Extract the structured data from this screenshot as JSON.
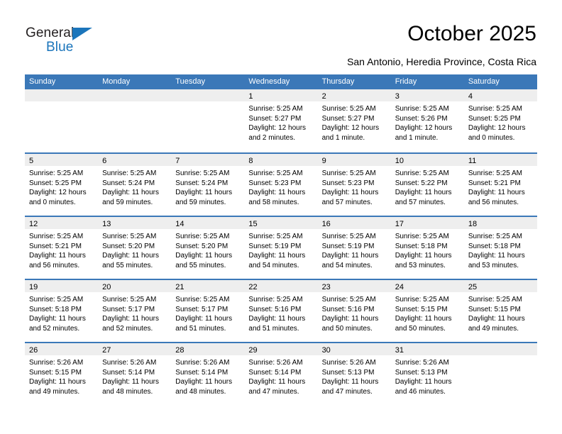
{
  "brand": {
    "name_top": "General",
    "name_bottom": "Blue",
    "accent_color": "#1b75bb"
  },
  "header": {
    "title": "October 2025",
    "subtitle": "San Antonio, Heredia Province, Costa Rica"
  },
  "calendar": {
    "header_color": "#3b78b8",
    "weekdays": [
      "Sunday",
      "Monday",
      "Tuesday",
      "Wednesday",
      "Thursday",
      "Friday",
      "Saturday"
    ],
    "weeks": [
      [
        {
          "day": "",
          "sunrise": "",
          "sunset": "",
          "daylight": "",
          "daylight2": ""
        },
        {
          "day": "",
          "sunrise": "",
          "sunset": "",
          "daylight": "",
          "daylight2": ""
        },
        {
          "day": "",
          "sunrise": "",
          "sunset": "",
          "daylight": "",
          "daylight2": ""
        },
        {
          "day": "1",
          "sunrise": "Sunrise: 5:25 AM",
          "sunset": "Sunset: 5:27 PM",
          "daylight": "Daylight: 12 hours",
          "daylight2": "and 2 minutes."
        },
        {
          "day": "2",
          "sunrise": "Sunrise: 5:25 AM",
          "sunset": "Sunset: 5:27 PM",
          "daylight": "Daylight: 12 hours",
          "daylight2": "and 1 minute."
        },
        {
          "day": "3",
          "sunrise": "Sunrise: 5:25 AM",
          "sunset": "Sunset: 5:26 PM",
          "daylight": "Daylight: 12 hours",
          "daylight2": "and 1 minute."
        },
        {
          "day": "4",
          "sunrise": "Sunrise: 5:25 AM",
          "sunset": "Sunset: 5:25 PM",
          "daylight": "Daylight: 12 hours",
          "daylight2": "and 0 minutes."
        }
      ],
      [
        {
          "day": "5",
          "sunrise": "Sunrise: 5:25 AM",
          "sunset": "Sunset: 5:25 PM",
          "daylight": "Daylight: 12 hours",
          "daylight2": "and 0 minutes."
        },
        {
          "day": "6",
          "sunrise": "Sunrise: 5:25 AM",
          "sunset": "Sunset: 5:24 PM",
          "daylight": "Daylight: 11 hours",
          "daylight2": "and 59 minutes."
        },
        {
          "day": "7",
          "sunrise": "Sunrise: 5:25 AM",
          "sunset": "Sunset: 5:24 PM",
          "daylight": "Daylight: 11 hours",
          "daylight2": "and 59 minutes."
        },
        {
          "day": "8",
          "sunrise": "Sunrise: 5:25 AM",
          "sunset": "Sunset: 5:23 PM",
          "daylight": "Daylight: 11 hours",
          "daylight2": "and 58 minutes."
        },
        {
          "day": "9",
          "sunrise": "Sunrise: 5:25 AM",
          "sunset": "Sunset: 5:23 PM",
          "daylight": "Daylight: 11 hours",
          "daylight2": "and 57 minutes."
        },
        {
          "day": "10",
          "sunrise": "Sunrise: 5:25 AM",
          "sunset": "Sunset: 5:22 PM",
          "daylight": "Daylight: 11 hours",
          "daylight2": "and 57 minutes."
        },
        {
          "day": "11",
          "sunrise": "Sunrise: 5:25 AM",
          "sunset": "Sunset: 5:21 PM",
          "daylight": "Daylight: 11 hours",
          "daylight2": "and 56 minutes."
        }
      ],
      [
        {
          "day": "12",
          "sunrise": "Sunrise: 5:25 AM",
          "sunset": "Sunset: 5:21 PM",
          "daylight": "Daylight: 11 hours",
          "daylight2": "and 56 minutes."
        },
        {
          "day": "13",
          "sunrise": "Sunrise: 5:25 AM",
          "sunset": "Sunset: 5:20 PM",
          "daylight": "Daylight: 11 hours",
          "daylight2": "and 55 minutes."
        },
        {
          "day": "14",
          "sunrise": "Sunrise: 5:25 AM",
          "sunset": "Sunset: 5:20 PM",
          "daylight": "Daylight: 11 hours",
          "daylight2": "and 55 minutes."
        },
        {
          "day": "15",
          "sunrise": "Sunrise: 5:25 AM",
          "sunset": "Sunset: 5:19 PM",
          "daylight": "Daylight: 11 hours",
          "daylight2": "and 54 minutes."
        },
        {
          "day": "16",
          "sunrise": "Sunrise: 5:25 AM",
          "sunset": "Sunset: 5:19 PM",
          "daylight": "Daylight: 11 hours",
          "daylight2": "and 54 minutes."
        },
        {
          "day": "17",
          "sunrise": "Sunrise: 5:25 AM",
          "sunset": "Sunset: 5:18 PM",
          "daylight": "Daylight: 11 hours",
          "daylight2": "and 53 minutes."
        },
        {
          "day": "18",
          "sunrise": "Sunrise: 5:25 AM",
          "sunset": "Sunset: 5:18 PM",
          "daylight": "Daylight: 11 hours",
          "daylight2": "and 53 minutes."
        }
      ],
      [
        {
          "day": "19",
          "sunrise": "Sunrise: 5:25 AM",
          "sunset": "Sunset: 5:18 PM",
          "daylight": "Daylight: 11 hours",
          "daylight2": "and 52 minutes."
        },
        {
          "day": "20",
          "sunrise": "Sunrise: 5:25 AM",
          "sunset": "Sunset: 5:17 PM",
          "daylight": "Daylight: 11 hours",
          "daylight2": "and 52 minutes."
        },
        {
          "day": "21",
          "sunrise": "Sunrise: 5:25 AM",
          "sunset": "Sunset: 5:17 PM",
          "daylight": "Daylight: 11 hours",
          "daylight2": "and 51 minutes."
        },
        {
          "day": "22",
          "sunrise": "Sunrise: 5:25 AM",
          "sunset": "Sunset: 5:16 PM",
          "daylight": "Daylight: 11 hours",
          "daylight2": "and 51 minutes."
        },
        {
          "day": "23",
          "sunrise": "Sunrise: 5:25 AM",
          "sunset": "Sunset: 5:16 PM",
          "daylight": "Daylight: 11 hours",
          "daylight2": "and 50 minutes."
        },
        {
          "day": "24",
          "sunrise": "Sunrise: 5:25 AM",
          "sunset": "Sunset: 5:15 PM",
          "daylight": "Daylight: 11 hours",
          "daylight2": "and 50 minutes."
        },
        {
          "day": "25",
          "sunrise": "Sunrise: 5:25 AM",
          "sunset": "Sunset: 5:15 PM",
          "daylight": "Daylight: 11 hours",
          "daylight2": "and 49 minutes."
        }
      ],
      [
        {
          "day": "26",
          "sunrise": "Sunrise: 5:26 AM",
          "sunset": "Sunset: 5:15 PM",
          "daylight": "Daylight: 11 hours",
          "daylight2": "and 49 minutes."
        },
        {
          "day": "27",
          "sunrise": "Sunrise: 5:26 AM",
          "sunset": "Sunset: 5:14 PM",
          "daylight": "Daylight: 11 hours",
          "daylight2": "and 48 minutes."
        },
        {
          "day": "28",
          "sunrise": "Sunrise: 5:26 AM",
          "sunset": "Sunset: 5:14 PM",
          "daylight": "Daylight: 11 hours",
          "daylight2": "and 48 minutes."
        },
        {
          "day": "29",
          "sunrise": "Sunrise: 5:26 AM",
          "sunset": "Sunset: 5:14 PM",
          "daylight": "Daylight: 11 hours",
          "daylight2": "and 47 minutes."
        },
        {
          "day": "30",
          "sunrise": "Sunrise: 5:26 AM",
          "sunset": "Sunset: 5:13 PM",
          "daylight": "Daylight: 11 hours",
          "daylight2": "and 47 minutes."
        },
        {
          "day": "31",
          "sunrise": "Sunrise: 5:26 AM",
          "sunset": "Sunset: 5:13 PM",
          "daylight": "Daylight: 11 hours",
          "daylight2": "and 46 minutes."
        },
        {
          "day": "",
          "sunrise": "",
          "sunset": "",
          "daylight": "",
          "daylight2": ""
        }
      ]
    ]
  }
}
